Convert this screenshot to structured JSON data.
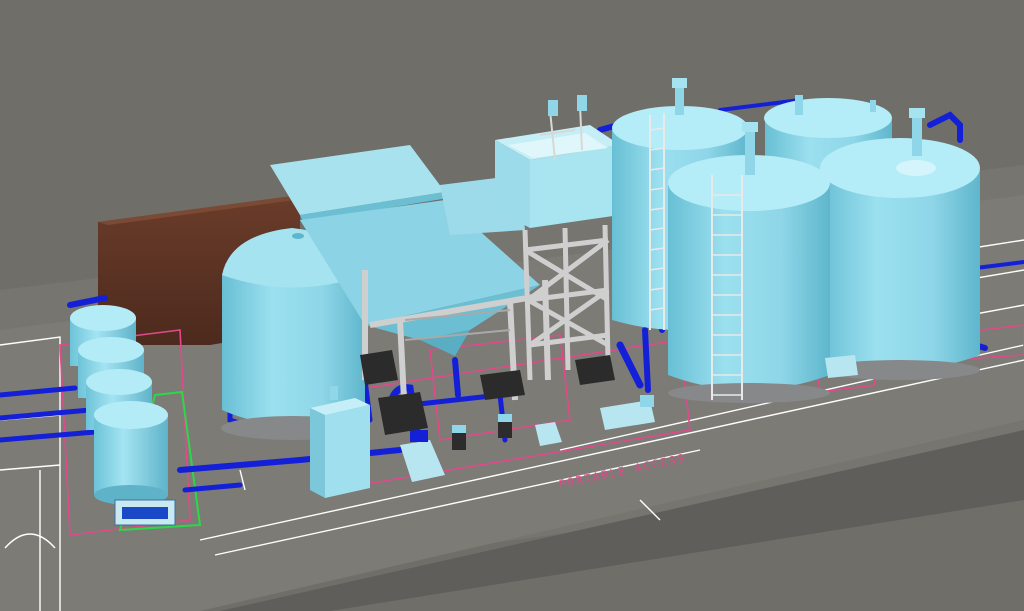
{
  "view": {
    "kind": "3D plant layout model view",
    "palette": {
      "background": "#6f6e69",
      "floor": "#76756f",
      "slab": "#858580",
      "tank": "#8ed6e8",
      "tank_shade": "#5fb6cc",
      "tank_light": "#b9ecf6",
      "pipe": "#1420d8",
      "steel": "#cfcfcf",
      "building": "#5a3325",
      "layout_line_white": "#ffffff",
      "layout_line_magenta": "#e04a8a",
      "layout_line_green": "#2bd84a"
    }
  },
  "annotations": {
    "floor_label": "PORTABLE ACCESS"
  },
  "equipment": {
    "small_vessels": [
      "vessel-1",
      "vessel-2",
      "vessel-3",
      "vessel-4"
    ],
    "large_tanks": [
      "tank-front-left",
      "tank-rear-1",
      "tank-rear-2",
      "tank-front-mid",
      "tank-front-right"
    ],
    "structures": [
      "hopper-conveyor",
      "mixing-tank-platform",
      "control-panel",
      "brown-building"
    ],
    "pumps": [
      "pump-1",
      "pump-2",
      "pump-3",
      "pump-4",
      "pump-5",
      "pump-6"
    ]
  }
}
